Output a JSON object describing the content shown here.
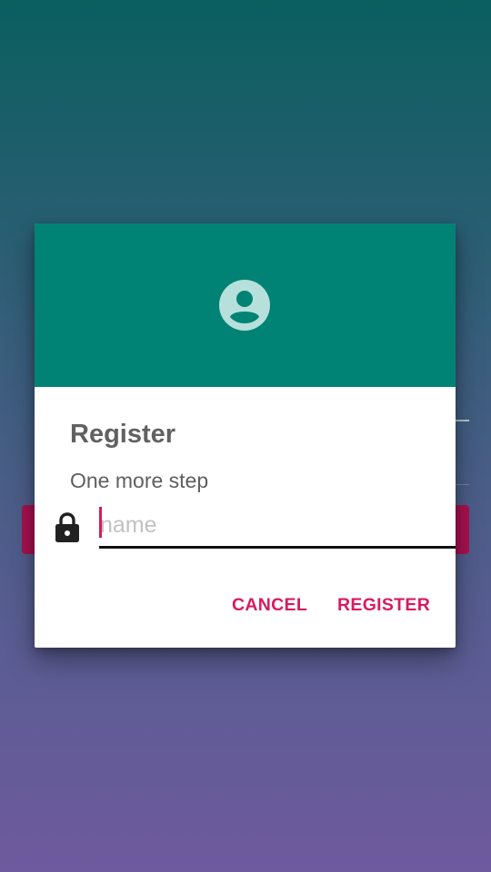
{
  "dialog": {
    "header_icon": "account-circle-icon",
    "header_color": "#008375",
    "title": "Register",
    "subtitle": "One more step",
    "field": {
      "icon": "lock-icon",
      "placeholder": "name",
      "value": ""
    },
    "actions": {
      "cancel_label": "CANCEL",
      "register_label": "REGISTER",
      "accent_color": "#d81b60"
    }
  }
}
